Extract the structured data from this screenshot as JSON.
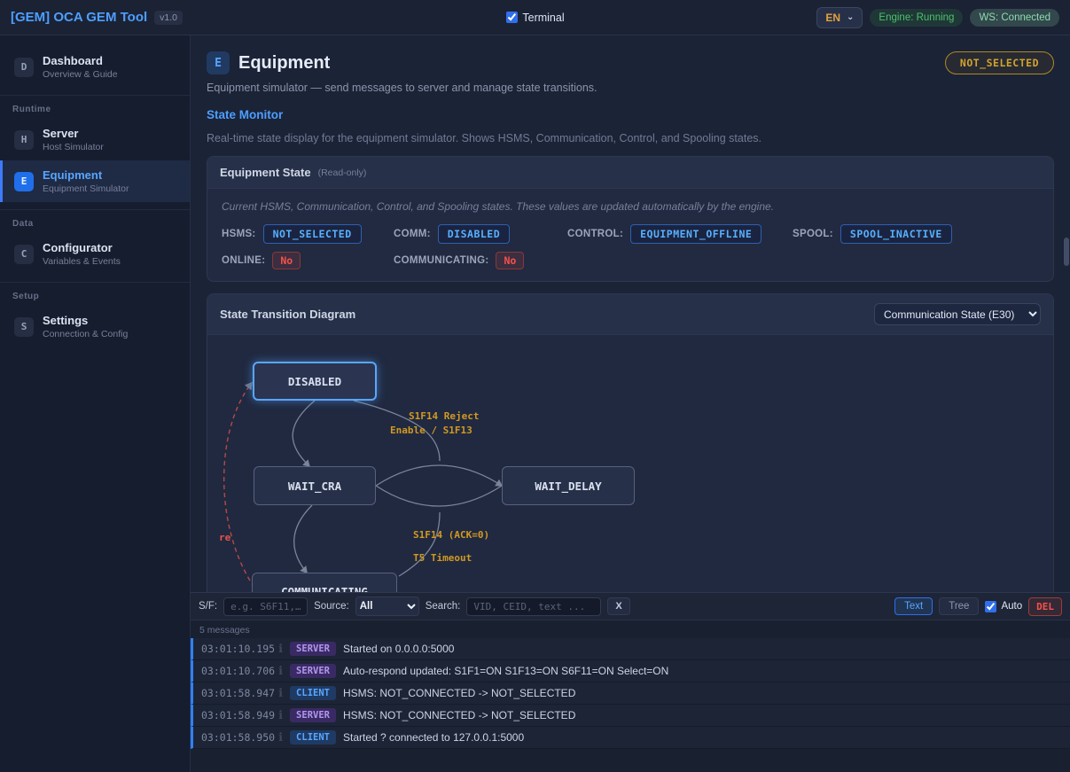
{
  "colors": {
    "accent": "#58a6ff",
    "warning": "#d29922",
    "success": "#3fb950",
    "danger": "#f85149"
  },
  "topbar": {
    "title": "[GEM] OCA GEM Tool",
    "version": "v1.0",
    "terminal_label": "Terminal",
    "language": "EN",
    "engine_status": "Engine: Running",
    "ws_status": "WS: Connected"
  },
  "sidebar": {
    "sections": {
      "runtime": "Runtime",
      "data": "Data",
      "setup": "Setup"
    },
    "items": [
      {
        "icon": "D",
        "label": "Dashboard",
        "sub": "Overview & Guide"
      },
      {
        "icon": "H",
        "label": "Server",
        "sub": "Host Simulator"
      },
      {
        "icon": "E",
        "label": "Equipment",
        "sub": "Equipment Simulator"
      },
      {
        "icon": "C",
        "label": "Configurator",
        "sub": "Variables & Events"
      },
      {
        "icon": "S",
        "label": "Settings",
        "sub": "Connection & Config"
      }
    ]
  },
  "page": {
    "icon": "E",
    "title": "Equipment",
    "subtitle": "Equipment simulator — send messages to server and manage state transitions.",
    "status_badge": "NOT_SELECTED",
    "section_title": "State Monitor",
    "section_description": "Real-time state display for the equipment simulator. Shows HSMS, Communication, Control, and Spooling states."
  },
  "equipment_state": {
    "title": "Equipment State",
    "readonly_label": "(Read-only)",
    "description": "Current HSMS, Communication, Control, and Spooling states. These values are updated automatically by the engine.",
    "fields": [
      {
        "label": "HSMS:",
        "value": "NOT_SELECTED"
      },
      {
        "label": "COMM:",
        "value": "DISABLED"
      },
      {
        "label": "CONTROL:",
        "value": "EQUIPMENT_OFFLINE"
      },
      {
        "label": "SPOOL:",
        "value": "SPOOL_INACTIVE"
      }
    ],
    "flags": [
      {
        "label": "ONLINE:",
        "value": "No"
      },
      {
        "label": "COMMUNICATING:",
        "value": "No"
      }
    ]
  },
  "diagram": {
    "title": "State Transition Diagram",
    "selected_view": "Communication State (E30)",
    "nodes": {
      "disabled": "DISABLED",
      "wait_cra": "WAIT_CRA",
      "wait_delay": "WAIT_DELAY",
      "communicating": "COMMUNICATING"
    },
    "edge_labels": {
      "reject": "S1F14 Reject",
      "enable": "Enable / S1F13",
      "ack": "S1F14 (ACK=0)",
      "t5": "T5 Timeout",
      "partial": "re"
    }
  },
  "terminal": {
    "sf_label": "S/F:",
    "sf_placeholder": "e.g. S6F11,…",
    "source_label": "Source:",
    "source_value": "All",
    "search_label": "Search:",
    "search_placeholder": "VID, CEID, text ...",
    "clear_button": "X",
    "view_text": "Text",
    "view_tree": "Tree",
    "auto_label": "Auto",
    "delete_button": "DEL",
    "message_count": "5 messages",
    "info_icon": "ℹ",
    "messages": [
      {
        "time": "03:01:10.195",
        "source": "SERVER",
        "text": "Started on 0.0.0.0:5000"
      },
      {
        "time": "03:01:10.706",
        "source": "SERVER",
        "text": "Auto-respond updated: S1F1=ON S1F13=ON S6F11=ON Select=ON"
      },
      {
        "time": "03:01:58.947",
        "source": "CLIENT",
        "text": "HSMS: NOT_CONNECTED -> NOT_SELECTED"
      },
      {
        "time": "03:01:58.949",
        "source": "SERVER",
        "text": "HSMS: NOT_CONNECTED -> NOT_SELECTED"
      },
      {
        "time": "03:01:58.950",
        "source": "CLIENT",
        "text": "Started ? connected to 127.0.0.1:5000"
      }
    ]
  }
}
